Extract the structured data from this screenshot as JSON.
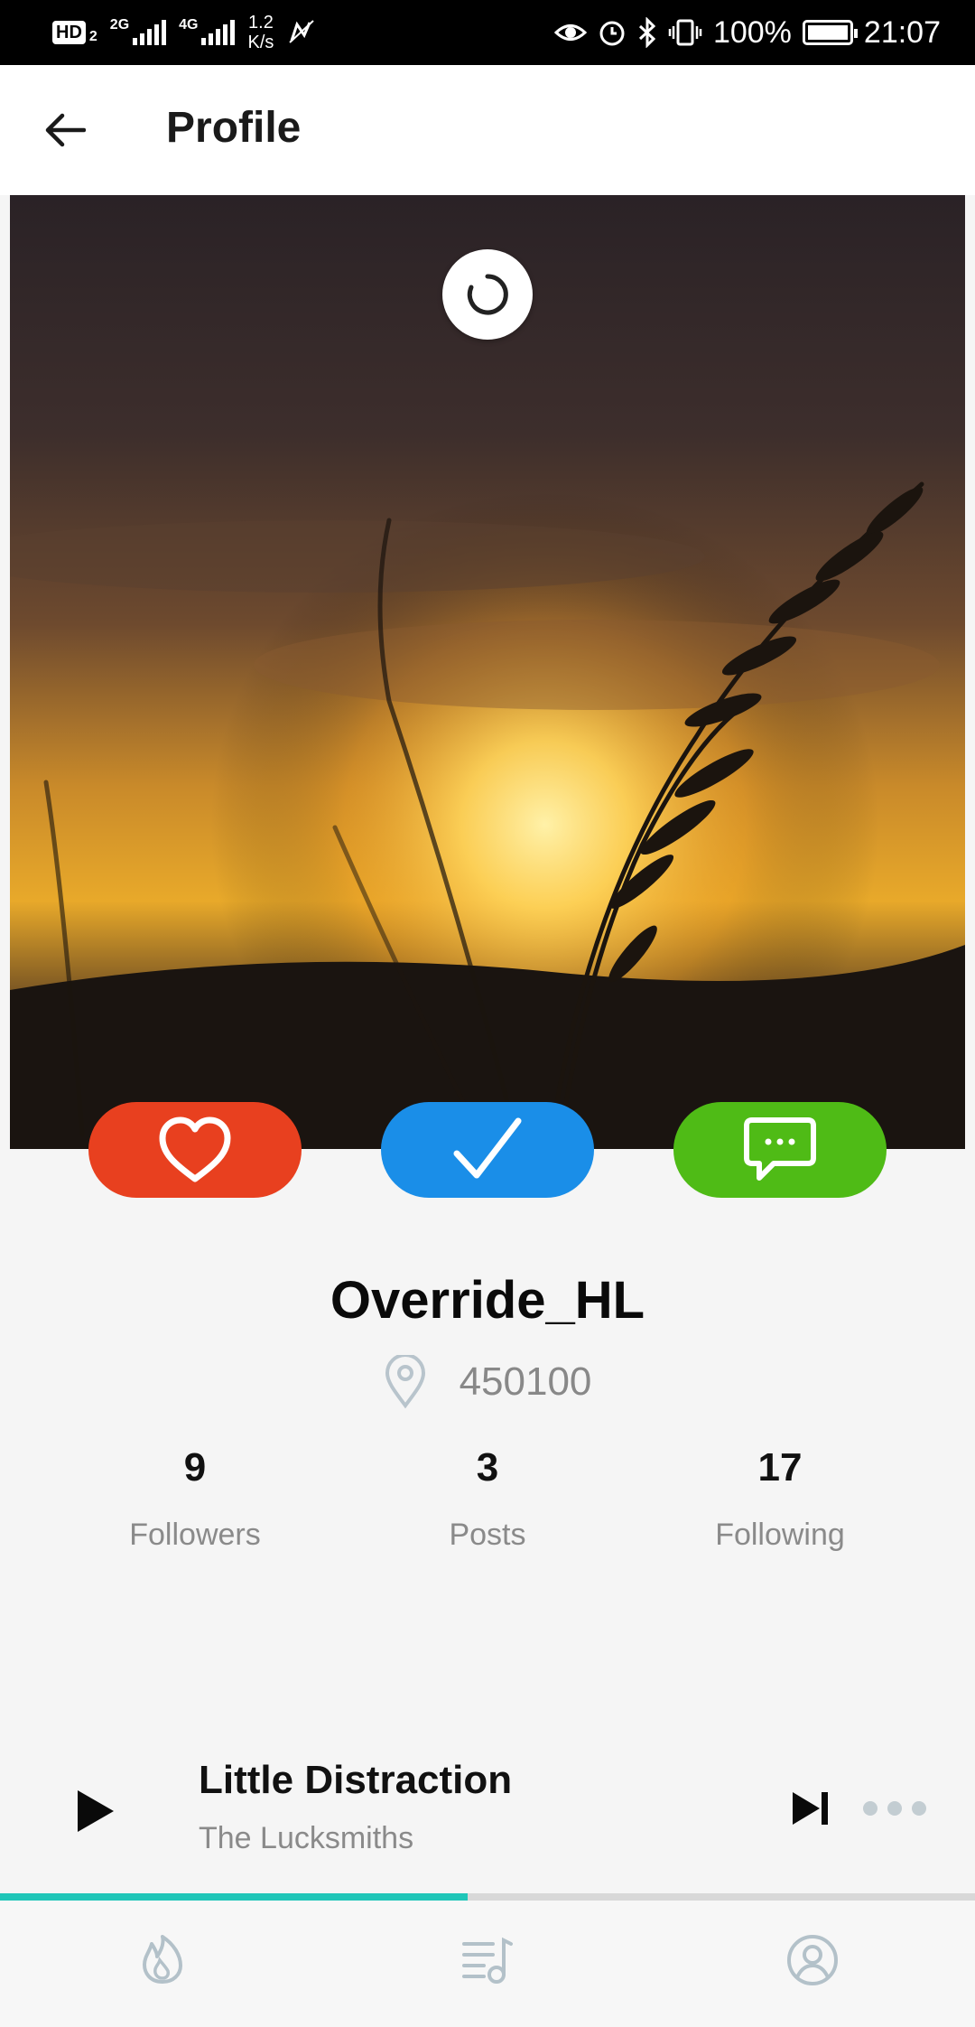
{
  "status_bar": {
    "hd_badge": "HD",
    "sim_number": "2",
    "network_1": "2G",
    "network_2": "4G",
    "speed_value": "1.2",
    "speed_unit": "K/s",
    "battery_percent": "100%",
    "time": "21:07"
  },
  "header": {
    "title": "Profile"
  },
  "profile": {
    "username": "Override_HL",
    "location": "450100",
    "stats": [
      {
        "count": "9",
        "label": "Followers"
      },
      {
        "count": "3",
        "label": "Posts"
      },
      {
        "count": "17",
        "label": "Following"
      }
    ]
  },
  "actions": {
    "like_color": "#e8401f",
    "follow_color": "#1a8ee8",
    "message_color": "#4fbb16"
  },
  "player": {
    "track_title": "Little Distraction",
    "artist": "The Lucksmiths",
    "progress": 0.48,
    "progress_color": "#1fc6b8"
  },
  "nav": {
    "items": [
      "fire-icon",
      "playlist-icon",
      "user-icon"
    ]
  }
}
